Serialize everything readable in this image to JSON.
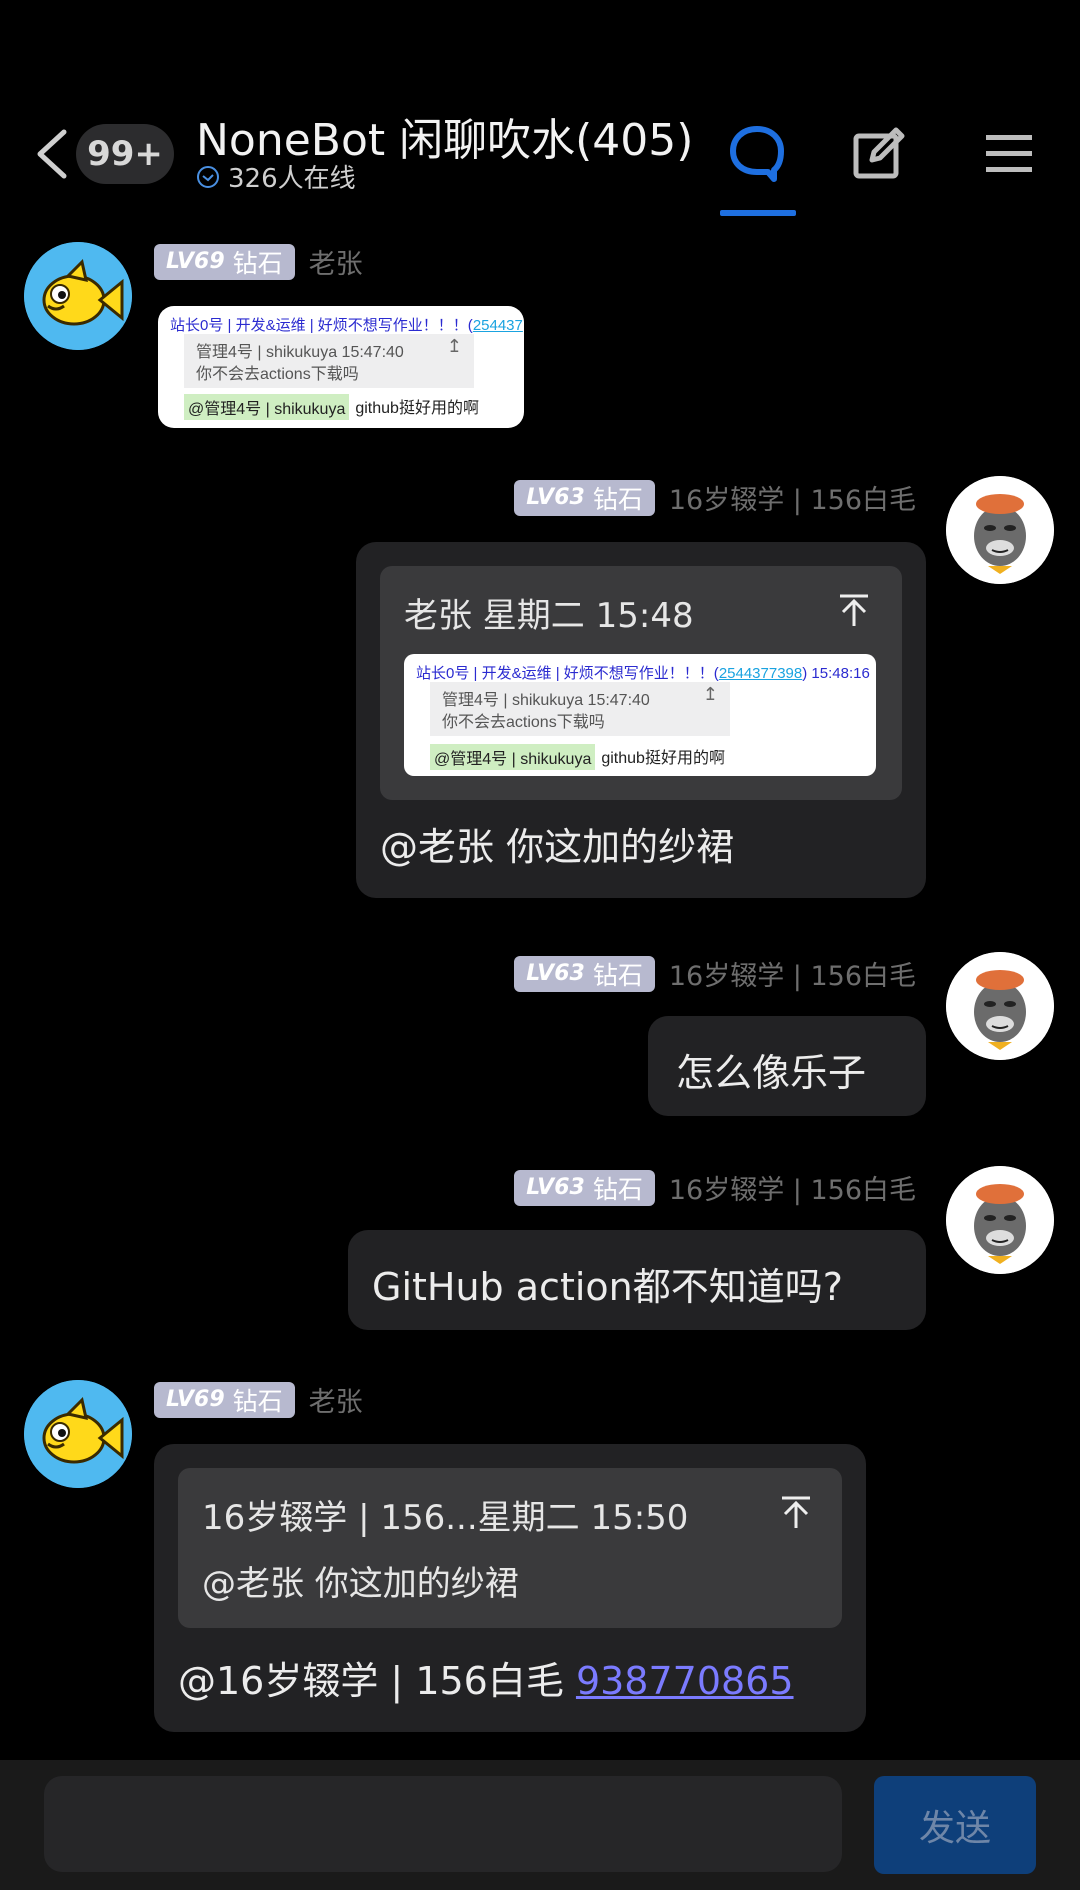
{
  "header": {
    "unread_count": "99+",
    "title": "NoneBot 闲聊吹水(405)",
    "online_text": "326人在线"
  },
  "messages": [
    {
      "level": "LV69",
      "rank": "钻石",
      "sender": "老张",
      "image": {
        "top_line": "站长0号 | 开发&运维 | 好烦不想写作业！！！(",
        "top_qq": "254437",
        "quote_head": "管理4号 | shikukuya   15:47:40",
        "quote_body": "你不会去actions下载吗",
        "mention": "@管理4号 | shikukuya",
        "reply_text": "github挺好用的啊"
      }
    },
    {
      "level": "LV63",
      "rank": "钻石",
      "sender": "16岁辍学 | 156白毛",
      "reply_head": "老张  星期二  15:48",
      "image": {
        "top_line": "站长0号 | 开发&运维 | 好烦不想写作业！！！(",
        "top_qq": "2544377398",
        "top_time": ")  15:48:16",
        "quote_head": "管理4号 | shikukuya   15:47:40",
        "quote_body": "你不会去actions下载吗",
        "mention": "@管理4号 | shikukuya",
        "reply_text": "github挺好用的啊"
      },
      "text": "@老张  你这加的纱裙"
    },
    {
      "level": "LV63",
      "rank": "钻石",
      "sender": "16岁辍学 | 156白毛",
      "text": "怎么像乐子"
    },
    {
      "level": "LV63",
      "rank": "钻石",
      "sender": "16岁辍学 | 156白毛",
      "text": "GitHub  action都不知道吗?"
    },
    {
      "level": "LV69",
      "rank": "钻石",
      "sender": "老张",
      "reply_head": "16岁辍学 | 156...星期二  15:50",
      "reply_quote": "@老张  你这加的纱裙",
      "mention_text": "@16岁辍学 | 156白毛 ",
      "link_text": "938770865"
    }
  ],
  "input": {
    "placeholder": "",
    "send_label": "发送"
  },
  "colors": {
    "accent": "#1e6fe0",
    "bubble": "#222224",
    "level_badge": "#b7b9cf",
    "link": "#7b7bff"
  }
}
